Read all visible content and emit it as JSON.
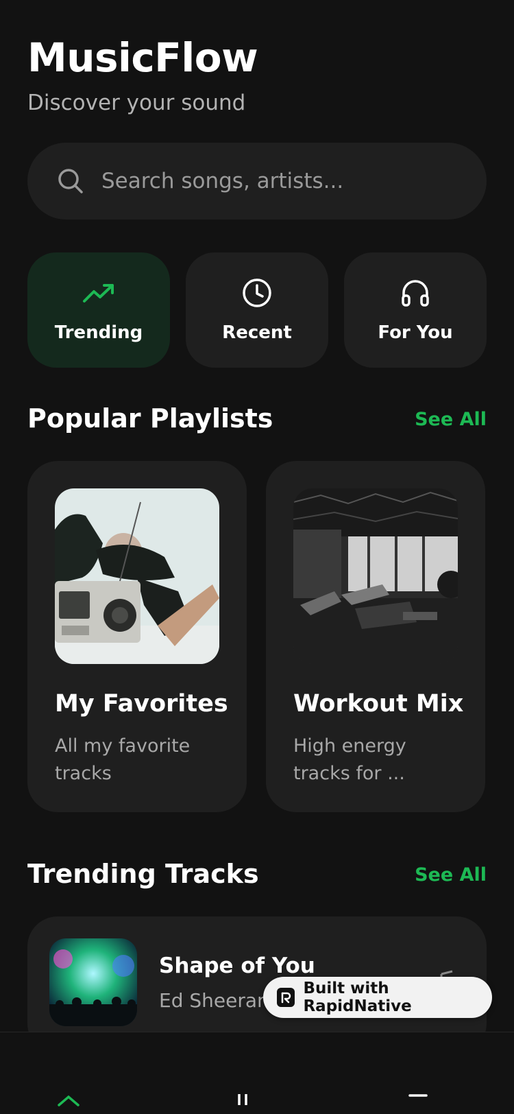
{
  "header": {
    "title": "MusicFlow",
    "subtitle": "Discover your sound"
  },
  "search": {
    "placeholder": "Search songs, artists...",
    "icon": "search-icon"
  },
  "categories": [
    {
      "label": "Trending",
      "icon": "trending-up-icon",
      "active": true
    },
    {
      "label": "Recent",
      "icon": "clock-icon",
      "active": false
    },
    {
      "label": "For You",
      "icon": "headphones-icon",
      "active": false
    }
  ],
  "popular": {
    "title": "Popular Playlists",
    "see_all": "See All",
    "playlists": [
      {
        "name": "My Favorites",
        "description": "All my favorite tracks",
        "cover": "person-with-boombox-photo"
      },
      {
        "name": "Workout Mix",
        "description": "High energy tracks for ...",
        "cover": "gym-interior-photo"
      }
    ]
  },
  "trending": {
    "title": "Trending Tracks",
    "see_all": "See All",
    "tracks": [
      {
        "title": "Shape of You",
        "artist": "Ed Sheeran",
        "art": "concert-crowd-photo",
        "icon": "music-note-icon"
      }
    ]
  },
  "badge": {
    "label": "Built with RapidNative"
  },
  "colors": {
    "background": "#121212",
    "card": "#1f1f1f",
    "accent": "#1db954",
    "active_category_bg": "#14291d",
    "muted_text": "#a8a8a8"
  }
}
